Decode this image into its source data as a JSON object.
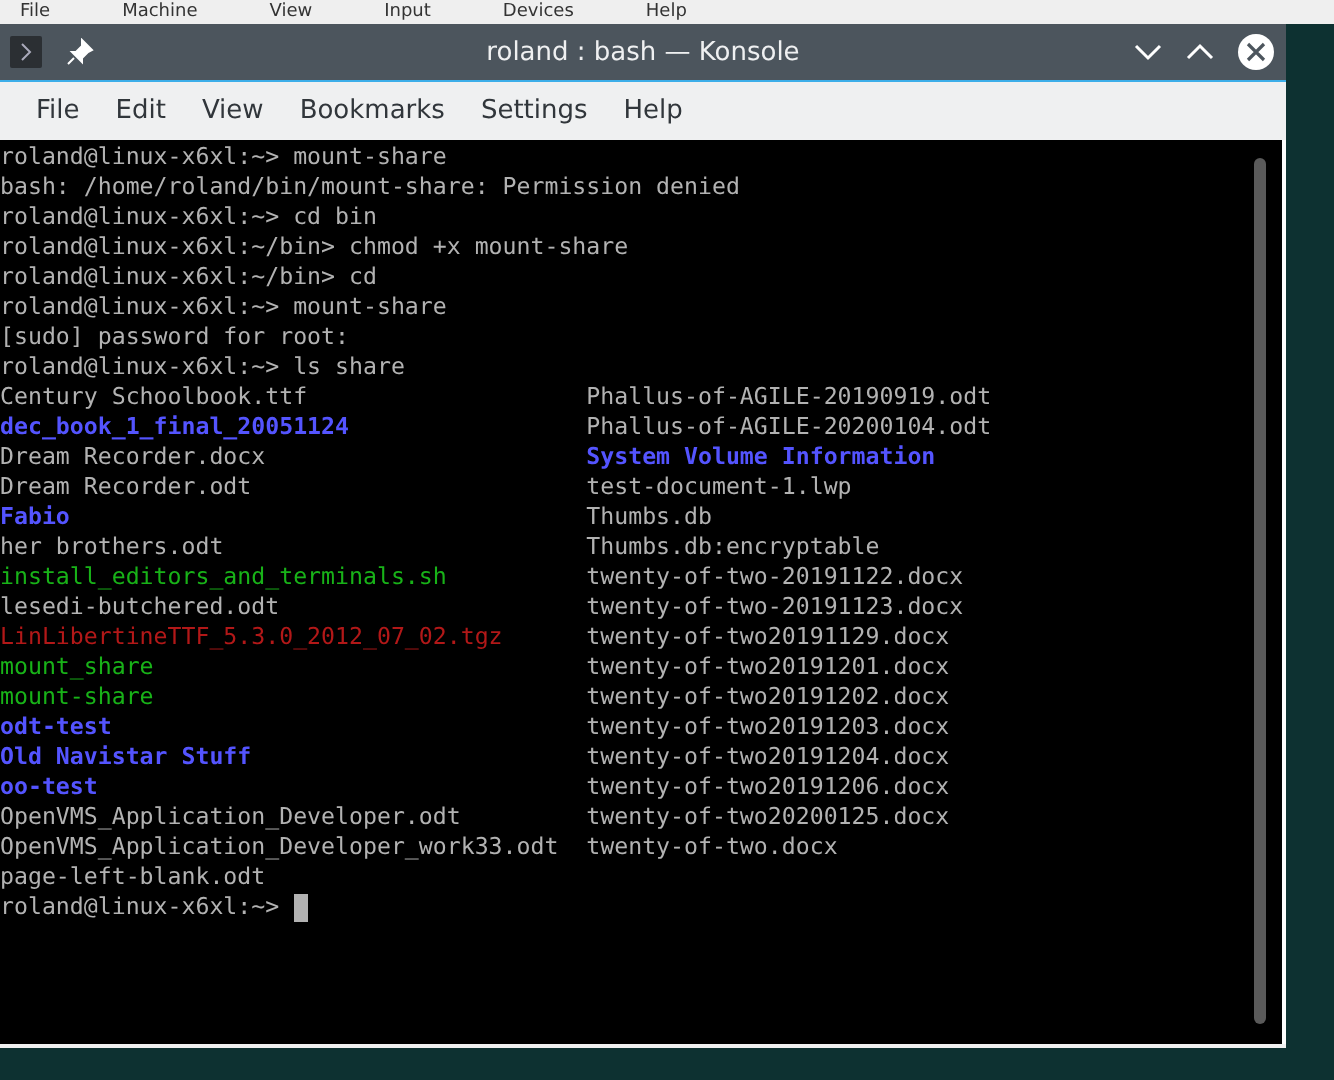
{
  "host_menu": [
    "File",
    "Machine",
    "View",
    "Input",
    "Devices",
    "Help"
  ],
  "window": {
    "title": "roland : bash — Konsole"
  },
  "menu": [
    "File",
    "Edit",
    "View",
    "Bookmarks",
    "Settings",
    "Help"
  ],
  "terminal": {
    "lines": [
      "roland@linux-x6xl:~> mount-share",
      "bash: /home/roland/bin/mount-share: Permission denied",
      "roland@linux-x6xl:~> cd bin",
      "roland@linux-x6xl:~/bin> chmod +x mount-share",
      "roland@linux-x6xl:~/bin> cd",
      "roland@linux-x6xl:~> mount-share",
      "[sudo] password for root:",
      "roland@linux-x6xl:~> ls share"
    ],
    "listing": [
      [
        {
          "name": "Century Schoolbook.ttf",
          "kind": "file"
        },
        {
          "name": "Phallus-of-AGILE-20190919.odt",
          "kind": "file"
        }
      ],
      [
        {
          "name": "dec_book_1_final_20051124",
          "kind": "directory"
        },
        {
          "name": "Phallus-of-AGILE-20200104.odt",
          "kind": "file"
        }
      ],
      [
        {
          "name": "Dream Recorder.docx",
          "kind": "file"
        },
        {
          "name": "System Volume Information",
          "kind": "directory"
        }
      ],
      [
        {
          "name": "Dream Recorder.odt",
          "kind": "file"
        },
        {
          "name": "test-document-1.lwp",
          "kind": "file"
        }
      ],
      [
        {
          "name": "Fabio",
          "kind": "directory"
        },
        {
          "name": "Thumbs.db",
          "kind": "file"
        }
      ],
      [
        {
          "name": "her brothers.odt",
          "kind": "file"
        },
        {
          "name": "Thumbs.db:encryptable",
          "kind": "file"
        }
      ],
      [
        {
          "name": "install_editors_and_terminals.sh",
          "kind": "executable"
        },
        {
          "name": "twenty-of-two-20191122.docx",
          "kind": "file"
        }
      ],
      [
        {
          "name": "lesedi-butchered.odt",
          "kind": "file"
        },
        {
          "name": "twenty-of-two-20191123.docx",
          "kind": "file"
        }
      ],
      [
        {
          "name": "LinLibertineTTF_5.3.0_2012_07_02.tgz",
          "kind": "archive"
        },
        {
          "name": "twenty-of-two20191129.docx",
          "kind": "file"
        }
      ],
      [
        {
          "name": "mount_share",
          "kind": "executable"
        },
        {
          "name": "twenty-of-two20191201.docx",
          "kind": "file"
        }
      ],
      [
        {
          "name": "mount-share",
          "kind": "executable"
        },
        {
          "name": "twenty-of-two20191202.docx",
          "kind": "file"
        }
      ],
      [
        {
          "name": "odt-test",
          "kind": "directory"
        },
        {
          "name": "twenty-of-two20191203.docx",
          "kind": "file"
        }
      ],
      [
        {
          "name": "Old Navistar Stuff",
          "kind": "directory"
        },
        {
          "name": "twenty-of-two20191204.docx",
          "kind": "file"
        }
      ],
      [
        {
          "name": "oo-test",
          "kind": "directory"
        },
        {
          "name": "twenty-of-two20191206.docx",
          "kind": "file"
        }
      ],
      [
        {
          "name": "OpenVMS_Application_Developer.odt",
          "kind": "file"
        },
        {
          "name": "twenty-of-two20200125.docx",
          "kind": "file"
        }
      ],
      [
        {
          "name": "OpenVMS_Application_Developer_work33.odt",
          "kind": "file"
        },
        {
          "name": "twenty-of-two.docx",
          "kind": "file"
        }
      ],
      [
        {
          "name": "page-left-blank.odt",
          "kind": "file"
        }
      ]
    ],
    "prompt": "roland@linux-x6xl:~>"
  }
}
